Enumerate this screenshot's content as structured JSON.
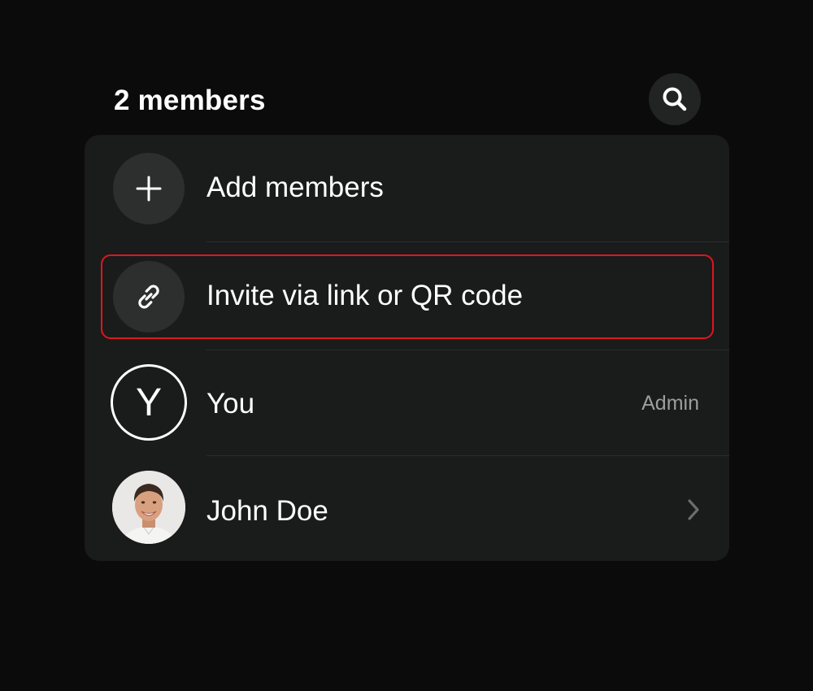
{
  "header": {
    "title": "2 members",
    "search_icon": "search-icon"
  },
  "rows": [
    {
      "label": "Add members",
      "icon": "plus-icon"
    },
    {
      "label": "Invite via link or QR code",
      "icon": "link-icon",
      "highlighted": true
    },
    {
      "label": "You",
      "avatar_letter": "Y",
      "role": "Admin"
    },
    {
      "label": "John Doe",
      "avatar": "photo",
      "icon": "chevron-right-icon"
    }
  ],
  "colors": {
    "background": "#0b0b0b",
    "card": "#1a1b1b",
    "icon_circle": "#2d2e2e",
    "highlight_border": "#e0161c",
    "secondary_text": "#9c9d9d"
  }
}
